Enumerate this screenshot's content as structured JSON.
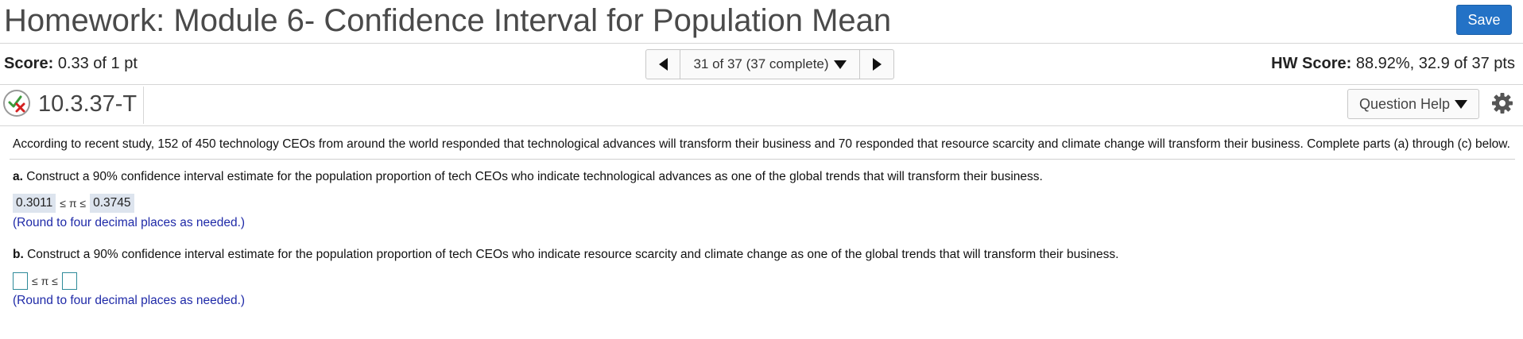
{
  "header": {
    "title": "Homework: Module 6- Confidence Interval for Population Mean",
    "save_label": "Save"
  },
  "scorebar": {
    "score_label": "Score:",
    "score_value": "0.33 of 1 pt",
    "progress_text": "31 of 37 (37 complete)",
    "hw_score_label": "HW Score:",
    "hw_score_value": "88.92%, 32.9 of 37 pts"
  },
  "question": {
    "id": "10.3.37-T",
    "help_label": "Question Help",
    "intro": "According to recent study, 152 of 450 technology CEOs from around the world responded that technological advances will transform their business and 70 responded that resource scarcity and climate change will transform their business. Complete parts (a) through (c) below.",
    "part_a_label": "a.",
    "part_a_text": "Construct a 90% confidence interval estimate for the population proportion of tech CEOs who indicate technological advances as one of the global trends that will transform their business.",
    "part_a_lower": "0.3011",
    "part_a_upper": "0.3745",
    "inequality": "≤ π ≤",
    "round_hint": "(Round to four decimal places as needed.)",
    "part_b_label": "b.",
    "part_b_text": "Construct a 90% confidence interval estimate for the population proportion of tech CEOs who indicate resource scarcity and climate change as one of the global trends that will transform their business."
  },
  "colors": {
    "save_button": "#2372c6",
    "hint_text": "#1f2aa8",
    "answer_highlight": "#dde4ee"
  },
  "icons": {
    "status": "partial-credit-check-x-icon",
    "prev": "triangle-left-icon",
    "next": "triangle-right-icon",
    "dropdown": "triangle-down-icon",
    "settings": "gear-icon"
  }
}
